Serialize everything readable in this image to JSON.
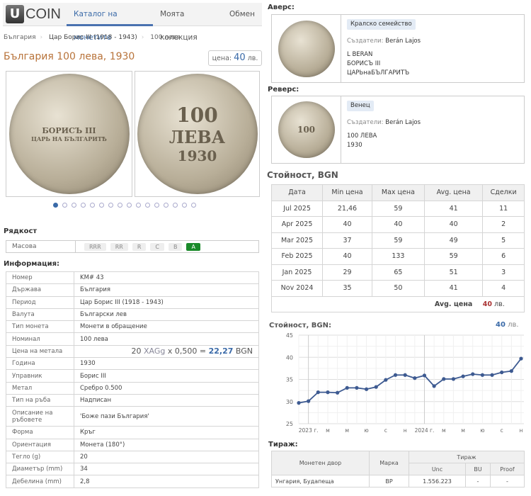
{
  "nav": {
    "logo_letter": "U",
    "logo_text": "COIN",
    "tabs": [
      "Каталог на монетите",
      "Моята колекция",
      "Обмен"
    ]
  },
  "breadcrumb": [
    "България",
    "Цар Борис III (1918 - 1943)",
    "100 лева"
  ],
  "title": "България 100 лева, 1930",
  "price": {
    "label": "цена:",
    "value": "40",
    "unit": "лв."
  },
  "coin_images": {
    "obverse_text": [
      "БОРИСЪ III",
      "ЦАРЬ НА БЪЛГАРИТѢ"
    ],
    "reverse_text": [
      "100",
      "ЛЕВА",
      "1930"
    ]
  },
  "gallery": {
    "count": 16,
    "active": 0
  },
  "rarity": {
    "heading": "Рядкост",
    "label": "Масова",
    "levels": [
      "RRR",
      "RR",
      "R",
      "C",
      "B",
      "A"
    ],
    "active": "A"
  },
  "info": {
    "heading": "Информация:",
    "rows": [
      [
        "Номер",
        "KM# 43"
      ],
      [
        "Държава",
        "България"
      ],
      [
        "Период",
        "Цар Борис III (1918 - 1943)"
      ],
      [
        "Валута",
        "Български лев"
      ],
      [
        "Тип монета",
        "Монети в обращение"
      ],
      [
        "Номинал",
        "100 лева"
      ],
      [
        "Цена на метала",
        ""
      ],
      [
        "Година",
        "1930"
      ],
      [
        "Управник",
        "Борис III"
      ],
      [
        "Метал",
        "Сребро 0.500"
      ],
      [
        "Тип на ръба",
        "Надписан"
      ],
      [
        "Описание на ръбовете",
        "'Боже пази България'"
      ],
      [
        "Форма",
        "Кръг"
      ],
      [
        "Ориентация",
        "Монета (180°)"
      ],
      [
        "Тегло (g)",
        "20"
      ],
      [
        "Диаметър (mm)",
        "34"
      ],
      [
        "Дебелина (mm)",
        "2,8"
      ]
    ],
    "metal": {
      "weight": "20",
      "metal": "XAGg",
      "x": "x 0,500 =",
      "value": "22,27",
      "currency": "BGN"
    }
  },
  "obverse": {
    "heading": "Аверс:",
    "tag": "Кралско семейство",
    "creators_label": "Създатели:",
    "creators": "Berán Lajos",
    "lines": [
      "L BERAN",
      "БОРИСЪ III",
      "ЦАРЬнаБЪЛГАРИТЪ"
    ]
  },
  "reverse": {
    "heading": "Реверс:",
    "tag": "Венец",
    "creators_label": "Създатели:",
    "creators": "Berán Lajos",
    "lines": [
      "100 ЛЕВА",
      "1930"
    ]
  },
  "value_table": {
    "heading": "Стойност, BGN",
    "columns": [
      "Дата",
      "Min цена",
      "Max цена",
      "Avg. цена",
      "Сделки"
    ],
    "rows": [
      [
        "Jul 2025",
        "21,46",
        "59",
        "41",
        "11"
      ],
      [
        "Apr 2025",
        "40",
        "40",
        "40",
        "2"
      ],
      [
        "Mar 2025",
        "37",
        "59",
        "49",
        "5"
      ],
      [
        "Feb 2025",
        "40",
        "133",
        "59",
        "6"
      ],
      [
        "Jan 2025",
        "29",
        "65",
        "51",
        "3"
      ],
      [
        "Nov 2024",
        "35",
        "50",
        "41",
        "4"
      ]
    ],
    "avg_label": "Avg. цена",
    "avg_value": "40",
    "avg_unit": "лв."
  },
  "chart_data": {
    "type": "line",
    "title": "Стойност, BGN:",
    "current": "40",
    "current_unit": "лв.",
    "x": [
      "Dec 2022",
      "Jan 2023",
      "Feb 2023",
      "Mar 2023",
      "Apr 2023",
      "May 2023",
      "Jun 2023",
      "Jul 2023",
      "Aug 2023",
      "Sep 2023",
      "Oct 2023",
      "Nov 2023",
      "Dec 2023",
      "Jan 2024",
      "Feb 2024",
      "Mar 2024",
      "Apr 2024",
      "May 2024",
      "Jun 2024",
      "Jul 2024",
      "Aug 2024",
      "Sep 2024",
      "Oct 2024",
      "Nov 2024"
    ],
    "values": [
      29.7,
      30.1,
      32.1,
      32.1,
      32.0,
      33.1,
      33.1,
      32.8,
      33.3,
      34.9,
      36.0,
      36.0,
      35.3,
      35.9,
      33.5,
      35.1,
      35.1,
      35.7,
      36.2,
      36.0,
      36.0,
      36.6,
      36.9,
      39.7
    ],
    "ylim": [
      25,
      45
    ],
    "yticks": [
      "45",
      "40",
      "35",
      "30",
      "25"
    ],
    "xtick_labels": [
      "2023 г.",
      "м",
      "м",
      "ю",
      "с",
      "н",
      "2024 г.",
      "м",
      "м",
      "ю",
      "с",
      "н"
    ],
    "color": "#3d5a91",
    "grid": true
  },
  "mintage": {
    "heading": "Тираж:",
    "cols": [
      "Монетен двор",
      "Марка",
      "Тираж",
      "Unc",
      "BU",
      "Proof"
    ],
    "rows": [
      [
        "Унгария, Будапеща",
        "BP",
        "1.556.223",
        "-",
        "-"
      ]
    ]
  }
}
